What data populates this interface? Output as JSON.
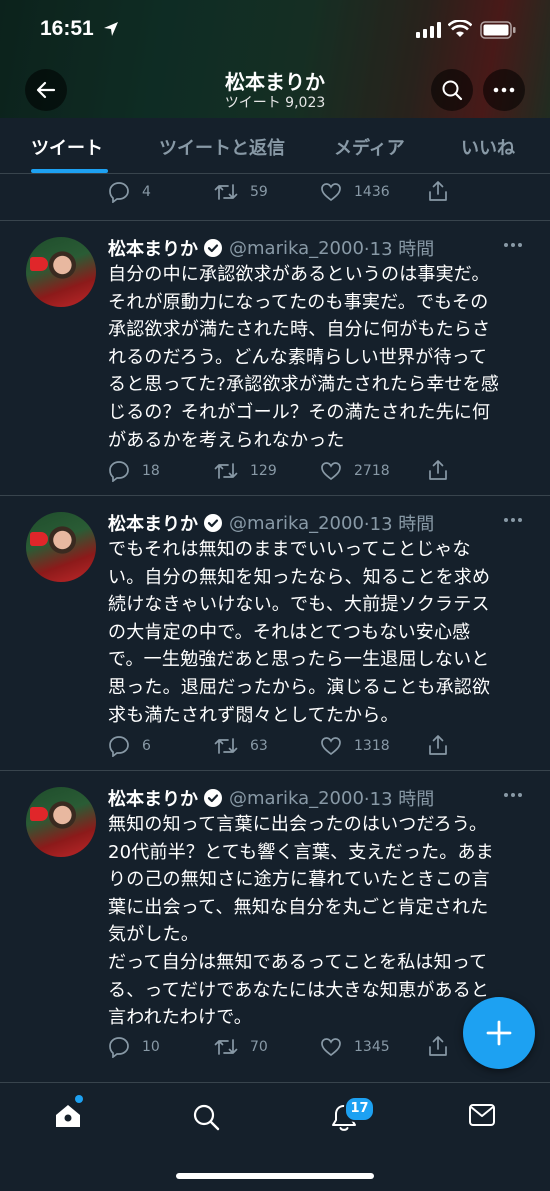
{
  "status_bar": {
    "time": "16:51"
  },
  "profile": {
    "name": "松本まりか",
    "tweet_count": "ツイート 9,023"
  },
  "tabs": [
    {
      "label": "ツイート",
      "active": true
    },
    {
      "label": "ツイートと返信",
      "active": false
    },
    {
      "label": "メディア",
      "active": false
    },
    {
      "label": "いいね",
      "active": false
    }
  ],
  "partial_tweet": {
    "replies": "4",
    "retweets": "59",
    "likes": "1436"
  },
  "tweets": [
    {
      "name": "松本まりか",
      "handle": "@marika_2000",
      "time": "·13 時間",
      "text": "自分の中に承認欲求があるというのは事実だ。\nそれが原動力になってたのも事実だ。でもその\n承認欲求が満たされた時、自分に何がもたらさ\nれるのだろう。どんな素晴らしい世界が待って\nると思ってた?承認欲求が満たされたら幸せを感\nじるの？それがゴール？その満たされた先に何\nがあるかを考えられなかった",
      "replies": "18",
      "retweets": "129",
      "likes": "2718"
    },
    {
      "name": "松本まりか",
      "handle": "@marika_2000",
      "time": "·13 時間",
      "text": "でもそれは無知のままでいいってことじゃな\nい。自分の無知を知ったなら、知ることを求め\n続けなきゃいけない。でも、大前提ソクラテス\nの大肯定の中で。それはとてつもない安心感\nで。一生勉強だあと思ったら一生退屈しないと\n思った。退屈だったから。演じることも承認欲\n求も満たされず悶々としてたから。",
      "replies": "6",
      "retweets": "63",
      "likes": "1318"
    },
    {
      "name": "松本まりか",
      "handle": "@marika_2000",
      "time": "·13 時間",
      "text": "無知の知って言葉に出会ったのはいつだろう。\n20代前半？とても響く言葉、支えだった。あま\nりの己の無知さに途方に暮れていたときこの言\n葉に出会って、無知な自分を丸ごと肯定された\n気がした。\nだって自分は無知であるってことを私は知って\nる、ってだけであなたには大きな知恵があると\n言われたわけで。",
      "replies": "10",
      "retweets": "70",
      "likes": "1345"
    }
  ],
  "notifications_badge": "17",
  "colors": {
    "accent": "#1da1f2",
    "background": "#15202b",
    "muted": "#8899a6",
    "divider": "#38444d"
  },
  "icons": [
    "back-arrow-icon",
    "search-icon",
    "more-icon",
    "reply-icon",
    "retweet-icon",
    "like-icon",
    "share-icon",
    "verified-icon",
    "compose-icon",
    "home-icon",
    "notifications-icon",
    "messages-icon"
  ]
}
